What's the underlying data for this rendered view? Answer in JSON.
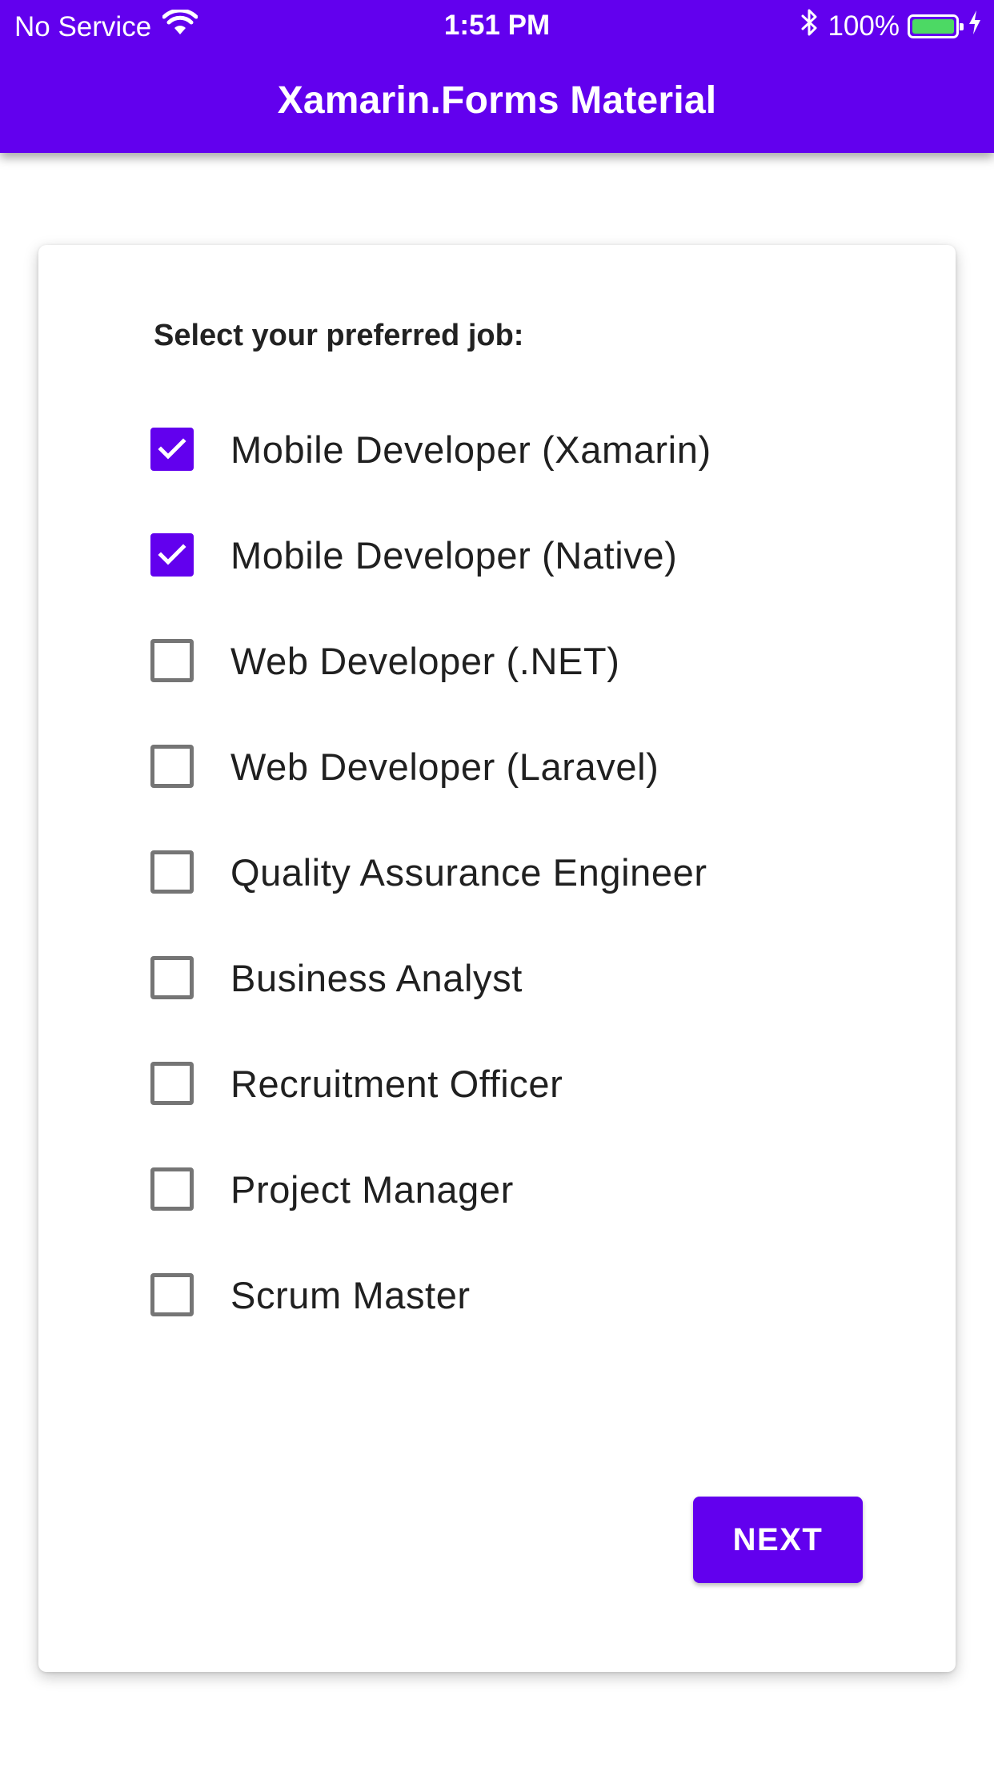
{
  "status_bar": {
    "carrier": "No Service",
    "time": "1:51 PM",
    "battery_percent": "100%",
    "icons": [
      "wifi-icon",
      "bluetooth-icon",
      "battery-icon",
      "charging-bolt-icon"
    ]
  },
  "app_bar": {
    "title": "Xamarin.Forms Material",
    "color": "#6200EE"
  },
  "form": {
    "prompt": "Select your preferred job:",
    "options": [
      {
        "label": "Mobile Developer (Xamarin)",
        "checked": true
      },
      {
        "label": "Mobile Developer (Native)",
        "checked": true
      },
      {
        "label": "Web Developer (.NET)",
        "checked": false
      },
      {
        "label": "Web Developer (Laravel)",
        "checked": false
      },
      {
        "label": "Quality Assurance Engineer",
        "checked": false
      },
      {
        "label": "Business Analyst",
        "checked": false
      },
      {
        "label": "Recruitment Officer",
        "checked": false
      },
      {
        "label": "Project Manager",
        "checked": false
      },
      {
        "label": "Scrum Master",
        "checked": false
      }
    ],
    "next_label": "NEXT"
  },
  "colors": {
    "accent": "#6200EE",
    "checkbox_unchecked": "#757575",
    "battery_fill": "#4CD964"
  }
}
